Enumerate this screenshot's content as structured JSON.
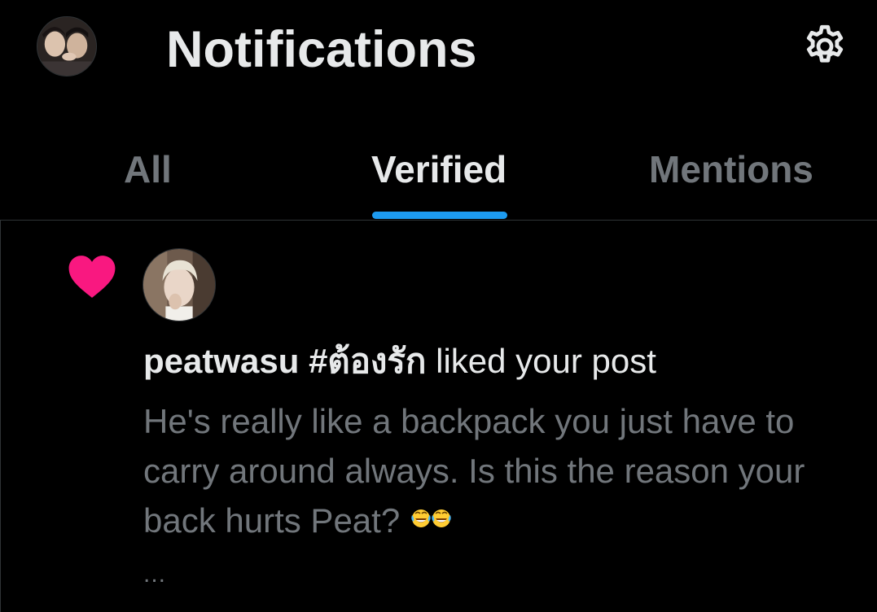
{
  "header": {
    "title": "Notifications",
    "avatar_icon": "profile-avatar",
    "settings_icon": "gear-icon"
  },
  "tabs": [
    {
      "label": "All",
      "active": false
    },
    {
      "label": "Verified",
      "active": true
    },
    {
      "label": "Mentions",
      "active": false
    }
  ],
  "notification": {
    "type_icon": "heart-icon",
    "type_color": "#f91880",
    "username": "peatwasu #ต้องรัก",
    "action": "liked your post",
    "post_text": "He's really like a backpack you just have to carry around always. Is this the reason your back hurts Peat?",
    "emoji": "😂😂",
    "more": "..."
  },
  "colors": {
    "background": "#000000",
    "primary_text": "#e7e9ea",
    "secondary_text": "#71767b",
    "accent": "#1d9bf0",
    "divider": "#2f3336"
  }
}
